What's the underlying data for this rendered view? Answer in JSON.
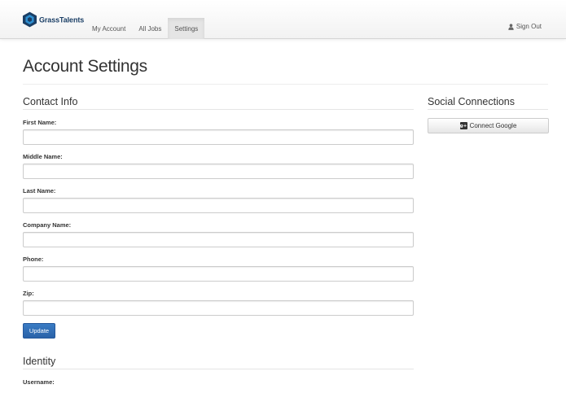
{
  "header": {
    "brand": "GrassTalents",
    "nav": [
      {
        "label": "My Account",
        "active": false
      },
      {
        "label": "All Jobs",
        "active": false
      },
      {
        "label": "Settings",
        "active": true
      }
    ],
    "sign_out": "Sign Out",
    "icons": {
      "brand": "grasstalents-logo-icon",
      "user": "user-icon"
    },
    "brand_color": "#1b3f66"
  },
  "page": {
    "title": "Account Settings"
  },
  "contact": {
    "heading": "Contact Info",
    "fields": [
      {
        "label": "First Name:",
        "value": ""
      },
      {
        "label": "Middle Name:",
        "value": ""
      },
      {
        "label": "Last Name:",
        "value": ""
      },
      {
        "label": "Company Name:",
        "value": ""
      },
      {
        "label": "Phone:",
        "value": ""
      },
      {
        "label": "Zip:",
        "value": ""
      }
    ],
    "update_label": "Update",
    "update_color": "#2f6db5"
  },
  "identity": {
    "heading": "Identity",
    "username_label": "Username:"
  },
  "social": {
    "heading": "Social Connections",
    "connect_google_label": "Connect Google",
    "google_icon": "google-plus-icon"
  }
}
